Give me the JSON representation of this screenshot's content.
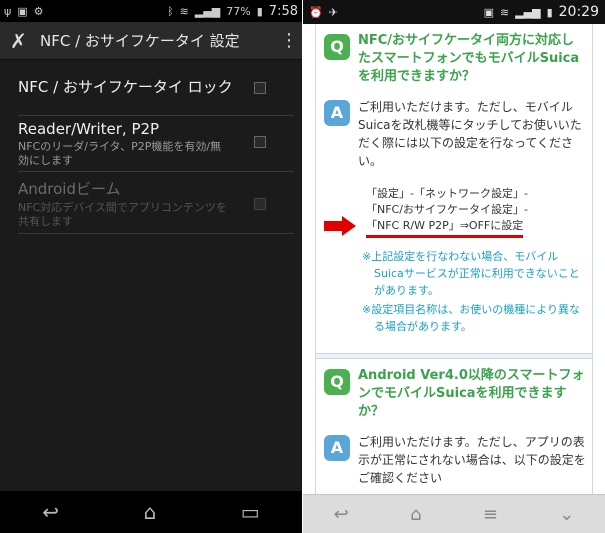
{
  "left": {
    "status": {
      "icons": [
        "usb-icon",
        "debug-icon",
        "android-icon",
        "bluetooth-icon",
        "wifi-icon",
        "signal-icon",
        "battery-icon"
      ],
      "battery": "77%",
      "time": "7:58"
    },
    "actionbar": {
      "title": "NFC / おサイフケータイ 設定",
      "menu_glyph": "⋮"
    },
    "prefs": [
      {
        "title": "NFC / おサイフケータイ ロック",
        "summary": "",
        "enabled": true
      },
      {
        "title": "Reader/Writer, P2P",
        "summary": "NFCのリーダ/ライタ、P2P機能を有効/無効にします",
        "enabled": true
      },
      {
        "title": "Androidビーム",
        "summary": "NFC対応デバイス間でアプリコンテンツを共有します",
        "enabled": false
      }
    ],
    "nav": {
      "back": "↩",
      "home": "⌂",
      "recent": "▭"
    }
  },
  "right": {
    "status": {
      "icons": [
        "alarm-icon",
        "satellite-icon",
        "vibrate-icon",
        "wifi-icon",
        "signal-icon",
        "battery-icon"
      ],
      "time": "20:29"
    },
    "qa1": {
      "q_badge": "Q",
      "question": "NFC/おサイフケータイ両方に対応したスマートフォンでもモバイルSuicaを利用できますか？",
      "a_badge": "A",
      "answer": "ご利用いただけます。ただし、モバイルSuicaを改札機等にタッチしてお使いいただく際には以下の設定を行なってください。",
      "setting_line1": "「設定」-「ネットワーク設定」-",
      "setting_line2": "「NFC/おサイフケータイ設定」-",
      "setting_line3": "「NFC R/W P2P」⇒OFFに設定",
      "note1": "※上記設定を行なわない場合、モバイルSuicaサービスが正常に利用できないことがあります。",
      "note2": "※設定項目名称は、お使いの機種により異なる場合があります。"
    },
    "qa2": {
      "q_badge": "Q",
      "question": "Android Ver4.0以降のスマートフォンでモバイルSuicaを利用できますか？",
      "a_badge": "A",
      "answer": "ご利用いただけます。ただし、アプリの表示が正常にされない場合は、以下の設定をご確認ください"
    },
    "nav": {
      "back": "↩",
      "home": "⌂",
      "menu": "≡",
      "down": "⌄"
    }
  }
}
